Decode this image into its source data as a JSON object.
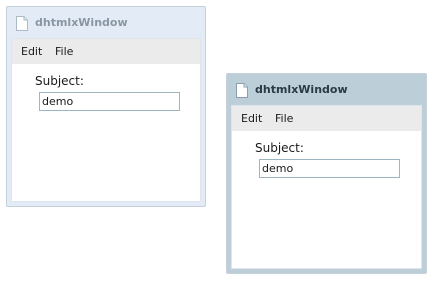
{
  "windows": [
    {
      "state": "inactive",
      "title": "dhtmlxWindow",
      "title_icon": "document-icon",
      "menu": [
        {
          "label": "Edit"
        },
        {
          "label": "File"
        }
      ],
      "form": {
        "subject_label": "Subject:",
        "subject_value": "demo"
      }
    },
    {
      "state": "active",
      "title": "dhtmlxWindow",
      "title_icon": "document-icon",
      "menu": [
        {
          "label": "Edit"
        },
        {
          "label": "File"
        }
      ],
      "form": {
        "subject_label": "Subject:",
        "subject_value": "demo"
      }
    }
  ],
  "colors": {
    "inactive_titlebar": "#e3ecf6",
    "active_titlebar": "#bccfd9",
    "menubar": "#ebebeb",
    "input_border": "#9db4c2"
  }
}
